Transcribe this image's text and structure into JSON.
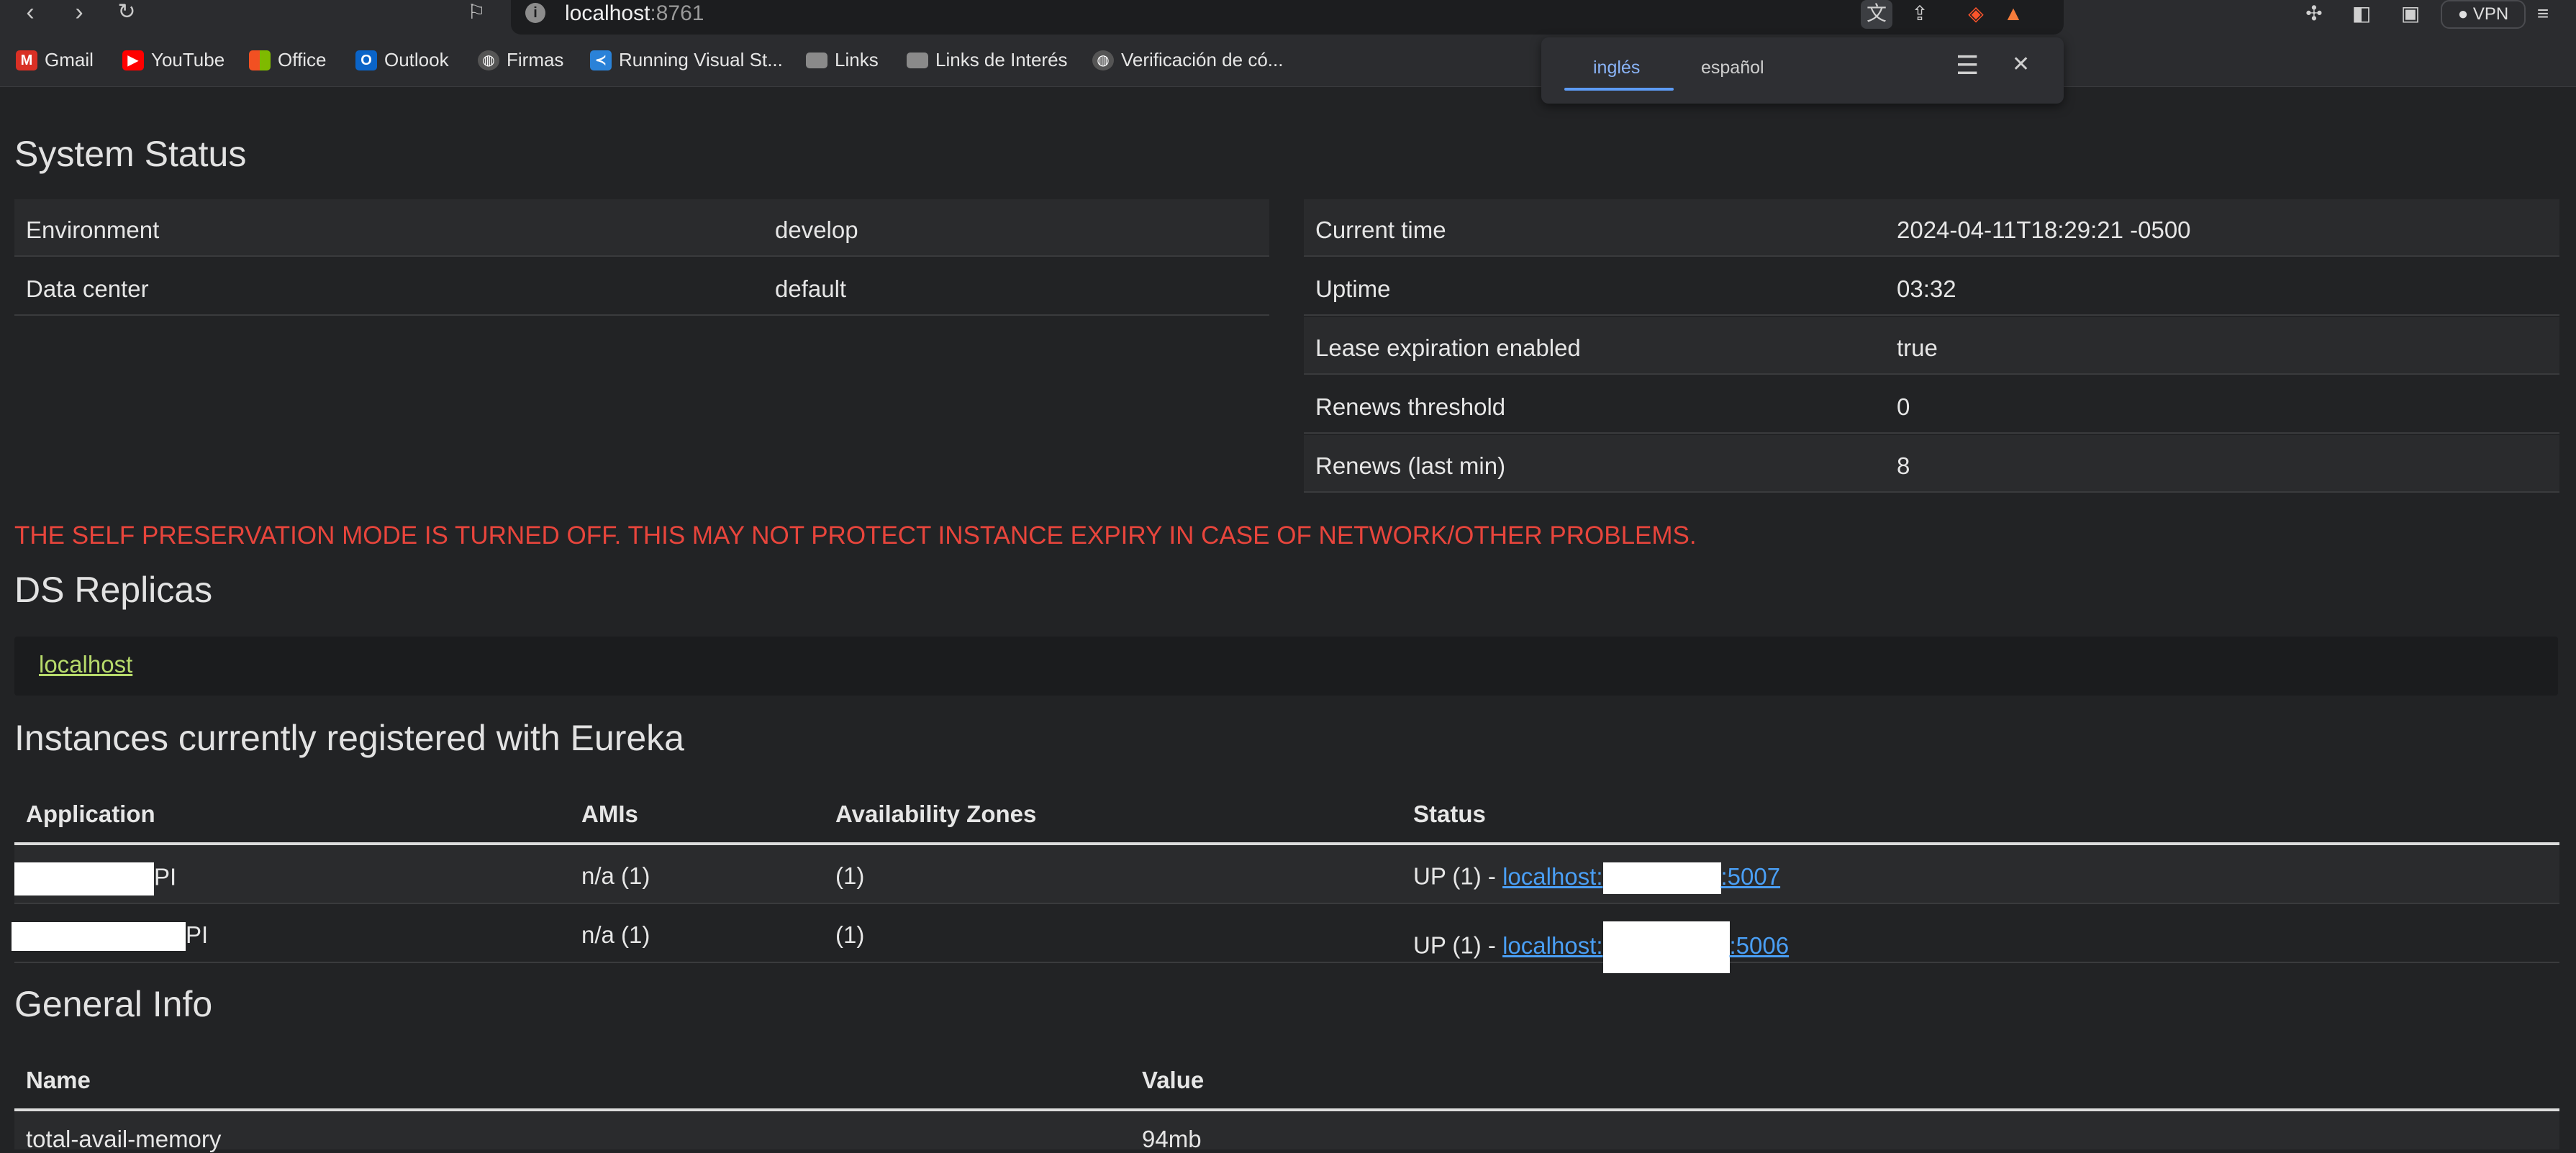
{
  "browser": {
    "url_host": "localhost",
    "url_port": ":8761",
    "vpn_label": "VPN",
    "bookmarks": [
      {
        "label": "Gmail",
        "icon": "gmail-icon"
      },
      {
        "label": "YouTube",
        "icon": "youtube-icon"
      },
      {
        "label": "Office",
        "icon": "office-icon"
      },
      {
        "label": "Outlook",
        "icon": "outlook-icon"
      },
      {
        "label": "Firmas",
        "icon": "globe-icon"
      },
      {
        "label": "Running Visual St...",
        "icon": "vscode-icon"
      },
      {
        "label": "Links",
        "icon": "folder-icon"
      },
      {
        "label": "Links de Interés",
        "icon": "folder-icon"
      },
      {
        "label": "Verificación de có...",
        "icon": "globe-icon"
      }
    ],
    "translate": {
      "tab_active": "inglés",
      "tab_other": "español"
    }
  },
  "system_status": {
    "title": "System Status",
    "left": [
      {
        "label": "Environment",
        "value": "develop"
      },
      {
        "label": "Data center",
        "value": "default"
      }
    ],
    "right": [
      {
        "label": "Current time",
        "value": "2024-04-11T18:29:21 -0500"
      },
      {
        "label": "Uptime",
        "value": "03:32"
      },
      {
        "label": "Lease expiration enabled",
        "value": "true"
      },
      {
        "label": "Renews threshold",
        "value": "0"
      },
      {
        "label": "Renews (last min)",
        "value": "8"
      }
    ]
  },
  "warning": "THE SELF PRESERVATION MODE IS TURNED OFF. THIS MAY NOT PROTECT INSTANCE EXPIRY IN CASE OF NETWORK/OTHER PROBLEMS.",
  "replicas": {
    "title": "DS Replicas",
    "link": "localhost"
  },
  "instances": {
    "title": "Instances currently registered with Eureka",
    "headers": [
      "Application",
      "AMIs",
      "Availability Zones",
      "Status"
    ],
    "rows": [
      {
        "app_suffix": "PI",
        "amis": "n/a (1)",
        "zones": "(1)",
        "status_prefix": "UP (1) - ",
        "link_start": "localhost:",
        "link_end": ":5007"
      },
      {
        "app_suffix": "PI",
        "amis": "n/a (1)",
        "zones": "(1)",
        "status_prefix": "UP (1) - ",
        "link_start": "localhost:",
        "link_end": ":5006"
      }
    ]
  },
  "general_info": {
    "title": "General Info",
    "headers": [
      "Name",
      "Value"
    ],
    "rows": [
      {
        "name": "total-avail-memory",
        "value": "94mb"
      }
    ]
  }
}
